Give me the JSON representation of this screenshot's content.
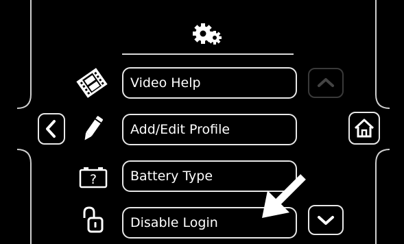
{
  "header": {
    "icon": "gears-icon"
  },
  "menu": {
    "items": [
      {
        "label": "Video Help",
        "icon": "film-icon"
      },
      {
        "label": "Add/Edit Profile",
        "icon": "pencil-icon"
      },
      {
        "label": "Battery Type",
        "icon": "battery-question-icon"
      },
      {
        "label": "Disable Login",
        "icon": "padlock-open-icon"
      }
    ]
  },
  "nav": {
    "back_icon": "chevron-left-icon",
    "home_icon": "home-icon",
    "scroll_up_icon": "chevron-up-icon",
    "scroll_down_icon": "chevron-down-icon",
    "scroll_up_enabled": false
  },
  "annotation": {
    "icon": "arrow-pointer-icon",
    "color": "#ffffff"
  },
  "colors": {
    "background": "#000000",
    "border": "#e8e8e8",
    "disabled": "#3a3a3a"
  }
}
